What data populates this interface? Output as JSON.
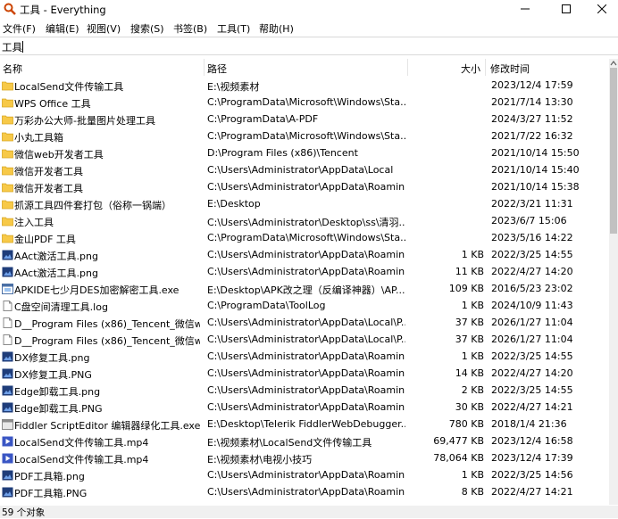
{
  "window": {
    "title": "工具 - Everything",
    "minimize": "—",
    "maximize": "☐",
    "close": "✕"
  },
  "menu": [
    "文件(F)",
    "编辑(E)",
    "视图(V)",
    "搜索(S)",
    "书签(B)",
    "工具(T)",
    "帮助(H)"
  ],
  "search": {
    "value": "工具"
  },
  "columns": {
    "name": "名称",
    "path": "路径",
    "size": "大小",
    "date": "修改时间"
  },
  "rows": [
    {
      "icon": "folder",
      "name": "LocalSend文件传输工具",
      "path": "E:\\视频素材",
      "size": "",
      "date": "2023/12/4 17:59"
    },
    {
      "icon": "folder",
      "name": "WPS Office 工具",
      "path": "C:\\ProgramData\\Microsoft\\Windows\\Sta...",
      "size": "",
      "date": "2021/7/14 13:30"
    },
    {
      "icon": "folder",
      "name": "万彩办公大师-批量图片处理工具",
      "path": "C:\\ProgramData\\A-PDF",
      "size": "",
      "date": "2024/3/27 11:52"
    },
    {
      "icon": "folder",
      "name": "小丸工具箱",
      "path": "C:\\ProgramData\\Microsoft\\Windows\\Sta...",
      "size": "",
      "date": "2021/7/22 16:32"
    },
    {
      "icon": "folder",
      "name": "微信web开发者工具",
      "path": "D:\\Program Files (x86)\\Tencent",
      "size": "",
      "date": "2021/10/14 15:50"
    },
    {
      "icon": "folder",
      "name": "微信开发者工具",
      "path": "C:\\Users\\Administrator\\AppData\\Local",
      "size": "",
      "date": "2021/10/14 15:40"
    },
    {
      "icon": "folder",
      "name": "微信开发者工具",
      "path": "C:\\Users\\Administrator\\AppData\\Roamin...",
      "size": "",
      "date": "2021/10/14 15:38"
    },
    {
      "icon": "folder",
      "name": "抓源工具四件套打包（俗称一锅端）",
      "path": "E:\\Desktop",
      "size": "",
      "date": "2022/3/21 11:31"
    },
    {
      "icon": "folder",
      "name": "注入工具",
      "path": "C:\\Users\\Administrator\\Desktop\\ss\\清羽...",
      "size": "",
      "date": "2023/6/7 15:06"
    },
    {
      "icon": "folder",
      "name": "金山PDF 工具",
      "path": "C:\\ProgramData\\Microsoft\\Windows\\Sta...",
      "size": "",
      "date": "2023/5/16 14:22"
    },
    {
      "icon": "image",
      "name": "AAct激活工具.png",
      "path": "C:\\Users\\Administrator\\AppData\\Roamin...",
      "size": "1 KB",
      "date": "2022/3/25 14:55"
    },
    {
      "icon": "image",
      "name": "AAct激活工具.png",
      "path": "C:\\Users\\Administrator\\AppData\\Roamin...",
      "size": "11 KB",
      "date": "2022/4/27 14:20"
    },
    {
      "icon": "exe",
      "name": "APKIDE七少月DES加密解密工具.exe",
      "path": "E:\\Desktop\\APK改之理（反编译神器）\\AP...",
      "size": "109 KB",
      "date": "2016/5/23 23:02"
    },
    {
      "icon": "doc",
      "name": "C盘空间清理工具.log",
      "path": "C:\\ProgramData\\ToolLog",
      "size": "1 KB",
      "date": "2024/10/9 11:43"
    },
    {
      "icon": "doc",
      "name": "D__Program Files (x86)_Tencent_微信w...",
      "path": "C:\\Users\\Administrator\\AppData\\Local\\P...",
      "size": "37 KB",
      "date": "2026/1/27 11:04"
    },
    {
      "icon": "doc",
      "name": "D__Program Files (x86)_Tencent_微信w...",
      "path": "C:\\Users\\Administrator\\AppData\\Local\\P...",
      "size": "37 KB",
      "date": "2026/1/27 11:04"
    },
    {
      "icon": "image",
      "name": "DX修复工具.png",
      "path": "C:\\Users\\Administrator\\AppData\\Roamin...",
      "size": "1 KB",
      "date": "2022/3/25 14:55"
    },
    {
      "icon": "image",
      "name": "DX修复工具.PNG",
      "path": "C:\\Users\\Administrator\\AppData\\Roamin...",
      "size": "14 KB",
      "date": "2022/4/27 14:20"
    },
    {
      "icon": "image",
      "name": "Edge卸载工具.png",
      "path": "C:\\Users\\Administrator\\AppData\\Roamin...",
      "size": "2 KB",
      "date": "2022/3/25 14:55"
    },
    {
      "icon": "image",
      "name": "Edge卸载工具.PNG",
      "path": "C:\\Users\\Administrator\\AppData\\Roamin...",
      "size": "30 KB",
      "date": "2022/4/27 14:21"
    },
    {
      "icon": "exe-gray",
      "name": "Fiddler ScriptEditor 编辑器绿化工具.exe",
      "path": "E:\\Desktop\\Telerik FiddlerWebDebugger...",
      "size": "780 KB",
      "date": "2018/1/4 21:36"
    },
    {
      "icon": "video",
      "name": "LocalSend文件传输工具.mp4",
      "path": "E:\\视频素材\\LocalSend文件传输工具",
      "size": "69,477 KB",
      "date": "2023/12/4 16:58"
    },
    {
      "icon": "video",
      "name": "LocalSend文件传输工具.mp4",
      "path": "E:\\视频素材\\电视小技巧",
      "size": "78,064 KB",
      "date": "2023/12/4 17:39"
    },
    {
      "icon": "image",
      "name": "PDF工具箱.png",
      "path": "C:\\Users\\Administrator\\AppData\\Roamin...",
      "size": "1 KB",
      "date": "2022/3/25 14:56"
    },
    {
      "icon": "image",
      "name": "PDF工具箱.PNG",
      "path": "C:\\Users\\Administrator\\AppData\\Roamin...",
      "size": "8 KB",
      "date": "2022/4/27 14:21"
    }
  ],
  "status": "59 个对象",
  "colors": {
    "folder": "#f7c948",
    "image": "#1f3d7a",
    "video": "#3a56c4",
    "accent": "#cc4400"
  }
}
